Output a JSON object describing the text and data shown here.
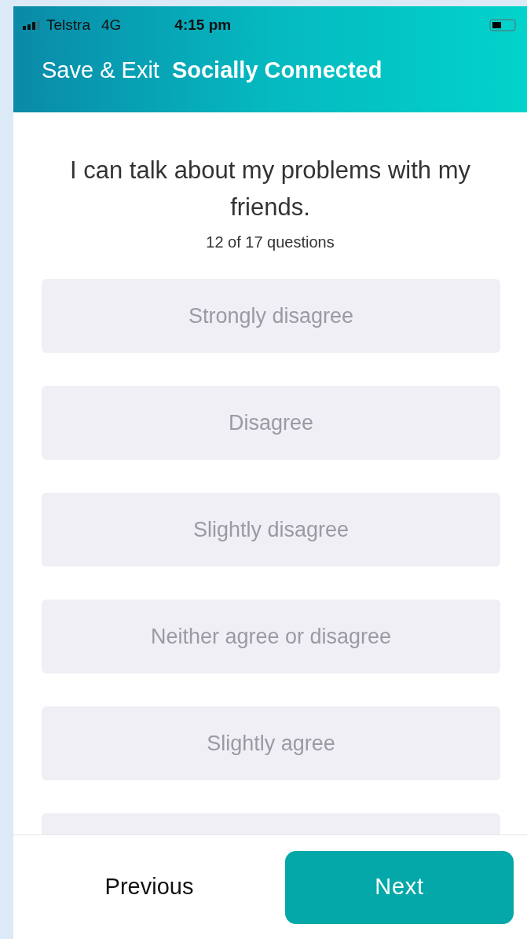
{
  "status_bar": {
    "carrier": "Telstra",
    "network": "4G",
    "time": "4:15 pm"
  },
  "header": {
    "back_label": "Save & Exit",
    "title": "Socially Connected"
  },
  "question": {
    "text": "I can talk about my problems with my friends.",
    "progress": "12 of 17 questions"
  },
  "options": [
    {
      "label": "Strongly disagree",
      "selected": false
    },
    {
      "label": "Disagree",
      "selected": false
    },
    {
      "label": "Slightly disagree",
      "selected": false
    },
    {
      "label": "Neither agree or disagree",
      "selected": false
    },
    {
      "label": "Slightly agree",
      "selected": false
    }
  ],
  "footer": {
    "previous": "Previous",
    "next": "Next"
  }
}
